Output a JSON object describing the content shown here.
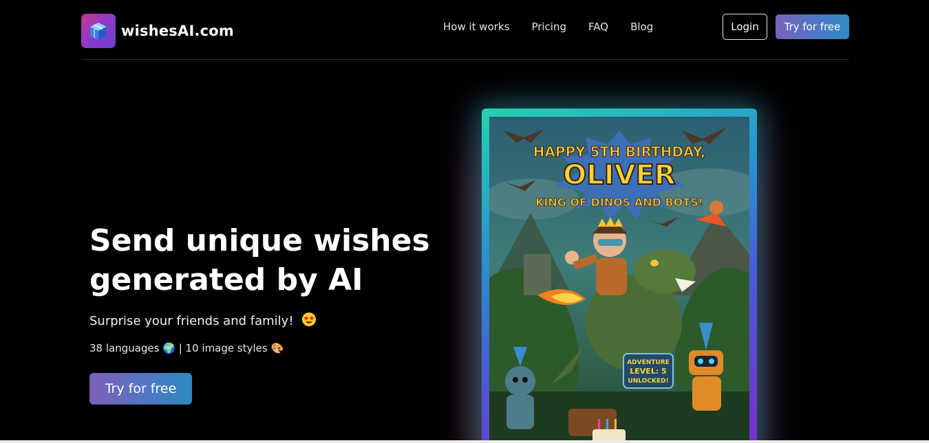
{
  "header": {
    "logo_text": "wishesAI.com",
    "nav": [
      "How it works",
      "Pricing",
      "FAQ",
      "Blog"
    ],
    "login_label": "Login",
    "try_label": "Try for free"
  },
  "hero": {
    "title": "Send unique wishes generated by AI",
    "subtitle": "Surprise your friends and family!",
    "meta": "38 languages 🌍 | 10 image styles 🎨",
    "cta_label": "Try for free"
  },
  "card": {
    "line1": "HAPPY 5TH BIRTHDAY,",
    "name": "OLIVER",
    "line3": "KING OF DINOS AND BOTS!",
    "badge_line1": "ADVENTURE",
    "badge_line2": "LEVEL: 5",
    "badge_line3": "UNLOCKED!"
  },
  "colors": {
    "accent_start": "#7a61bb",
    "accent_end": "#2e8bc3",
    "background": "#000000"
  }
}
